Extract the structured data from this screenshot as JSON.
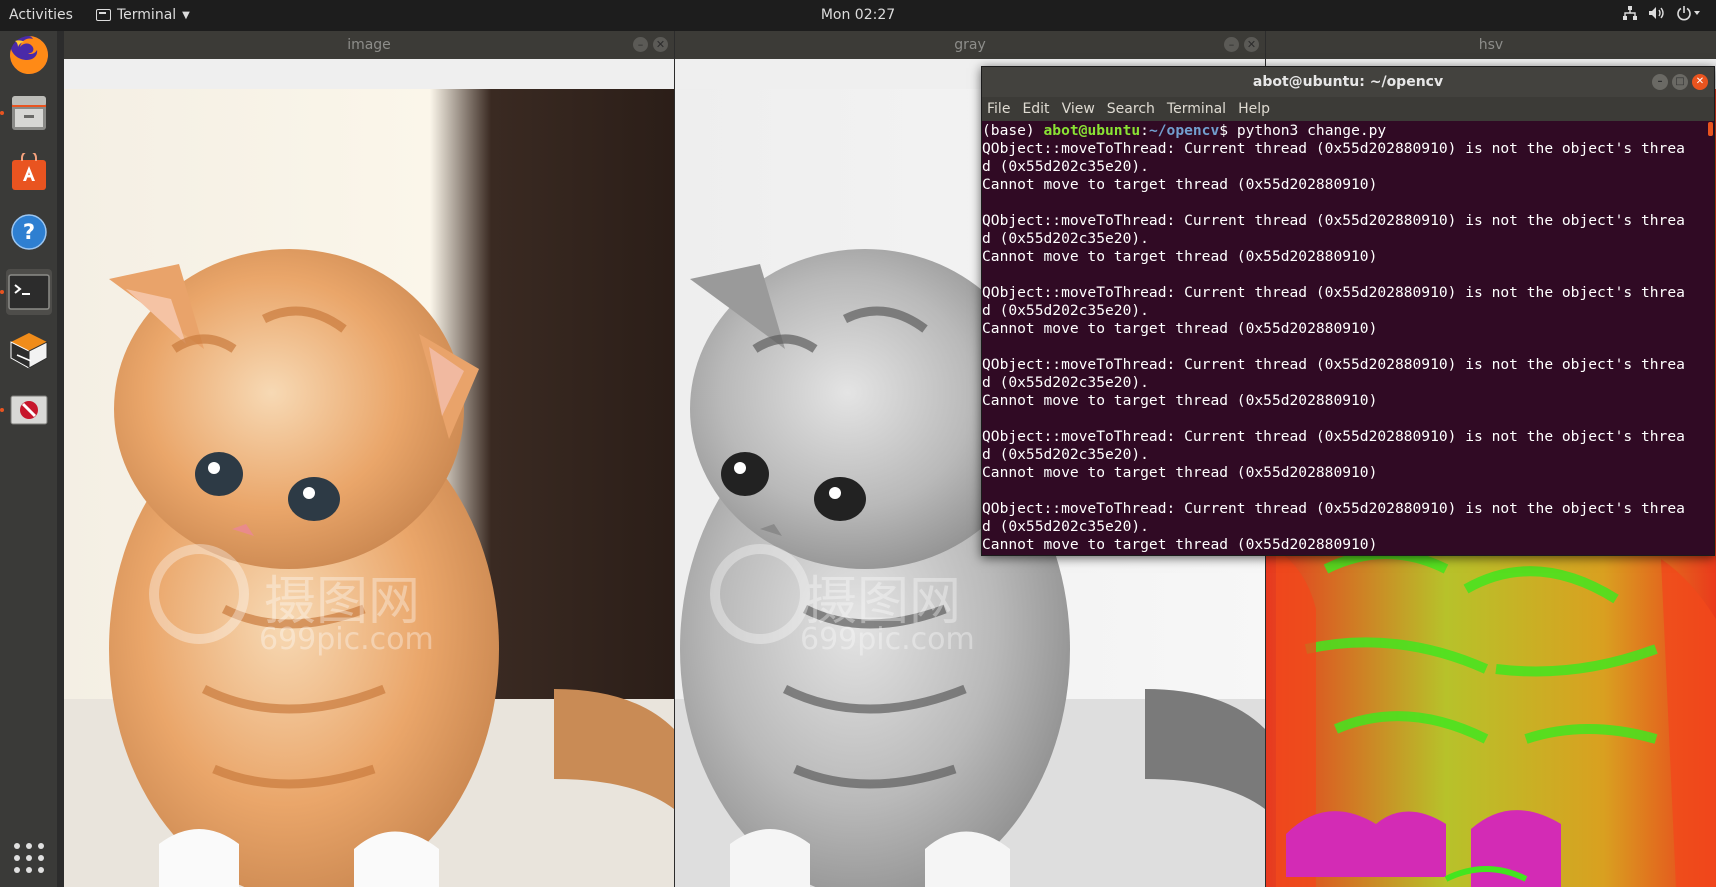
{
  "topbar": {
    "activities": "Activities",
    "app_name": "Terminal",
    "clock": "Mon 02:27"
  },
  "dock": {
    "items": [
      "firefox-icon",
      "files-icon",
      "software-icon",
      "help-icon",
      "terminal-icon",
      "virtualbox-icon",
      "no-entry-icon"
    ],
    "show_apps": "apps-grid-icon"
  },
  "windows": {
    "image": {
      "title": "image"
    },
    "gray": {
      "title": "gray"
    },
    "hsv": {
      "title": "hsv"
    }
  },
  "watermark": {
    "brand": "摄图网",
    "url": "699pic.com"
  },
  "terminal": {
    "title": "abot@ubuntu: ~/opencv",
    "menu": [
      "File",
      "Edit",
      "View",
      "Search",
      "Terminal",
      "Help"
    ],
    "prompt": {
      "env": "(base) ",
      "user": "abot@ubuntu",
      "sep": ":",
      "path": "~/opencv",
      "dollar": "$ ",
      "command": "python3 change.py"
    },
    "lines": [
      "QObject::moveToThread: Current thread (0x55d202880910) is not the object's threa",
      "d (0x55d202c35e20).",
      "Cannot move to target thread (0x55d202880910)",
      "",
      "QObject::moveToThread: Current thread (0x55d202880910) is not the object's threa",
      "d (0x55d202c35e20).",
      "Cannot move to target thread (0x55d202880910)",
      "",
      "QObject::moveToThread: Current thread (0x55d202880910) is not the object's threa",
      "d (0x55d202c35e20).",
      "Cannot move to target thread (0x55d202880910)",
      "",
      "QObject::moveToThread: Current thread (0x55d202880910) is not the object's threa",
      "d (0x55d202c35e20).",
      "Cannot move to target thread (0x55d202880910)",
      "",
      "QObject::moveToThread: Current thread (0x55d202880910) is not the object's threa",
      "d (0x55d202c35e20).",
      "Cannot move to target thread (0x55d202880910)",
      "",
      "QObject::moveToThread: Current thread (0x55d202880910) is not the object's threa",
      "d (0x55d202c35e20).",
      "Cannot move to target thread (0x55d202880910)"
    ]
  },
  "colors": {
    "accent": "#e95420",
    "terminal_bg": "#300a24",
    "prompt_user": "#8ae234",
    "prompt_path": "#729fcf"
  }
}
